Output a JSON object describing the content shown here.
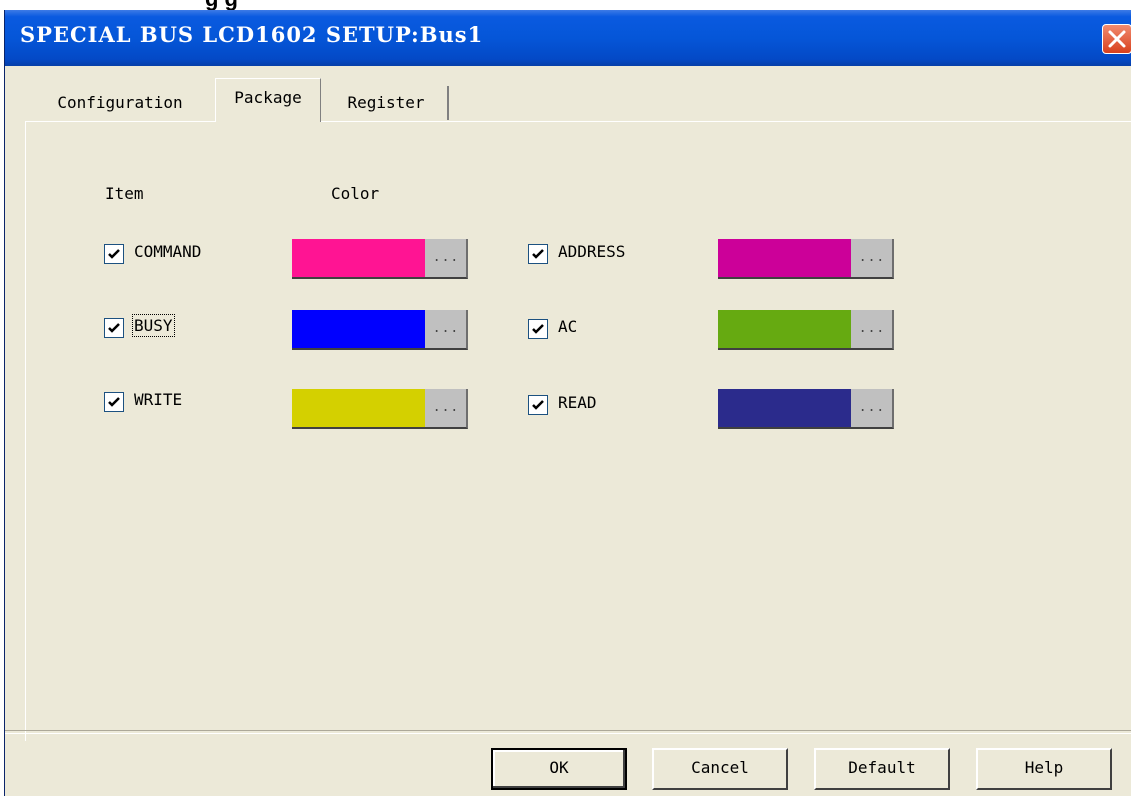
{
  "window": {
    "title": "SPECIAL BUS LCD1602 SETUP:Bus1"
  },
  "tabs": [
    {
      "label": "Configuration"
    },
    {
      "label": "Package",
      "active": true
    },
    {
      "label": "Register"
    }
  ],
  "headers": {
    "item": "Item",
    "color": "Color"
  },
  "items": [
    {
      "label": "COMMAND",
      "checked": true,
      "color": "#ff1493"
    },
    {
      "label": "BUSY",
      "checked": true,
      "color": "#0000ff",
      "focused": true
    },
    {
      "label": "WRITE",
      "checked": true,
      "color": "#d4d000"
    },
    {
      "label": "ADDRESS",
      "checked": true,
      "color": "#cc0099"
    },
    {
      "label": "AC",
      "checked": true,
      "color": "#66aa11"
    },
    {
      "label": "READ",
      "checked": true,
      "color": "#2b2b8c"
    }
  ],
  "color_button_label": "...",
  "buttons": {
    "ok": "OK",
    "cancel": "Cancel",
    "default": "Default",
    "help": "Help"
  },
  "icons": {
    "close": "close-icon",
    "check": "check-icon"
  }
}
